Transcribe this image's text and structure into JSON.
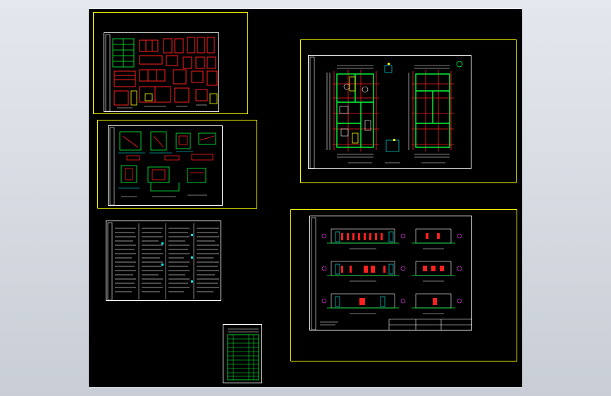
{
  "viewport": {
    "background_color": "#000000",
    "outer_color": "#d6dbe2"
  },
  "colors": {
    "frame": "#ffff00",
    "sheet_border": "#ffffff",
    "red": "#ff2020",
    "green": "#00ff3c",
    "cyan": "#00ffff",
    "white": "#ffffff",
    "magenta": "#ff40ff"
  },
  "sheets": [
    {
      "id": "sheet-door-window-details",
      "kind": "drawing"
    },
    {
      "id": "sheet-construction-details",
      "kind": "drawing"
    },
    {
      "id": "sheet-design-notes",
      "kind": "text"
    },
    {
      "id": "sheet-drawing-index",
      "kind": "table"
    },
    {
      "id": "sheet-floor-plans",
      "kind": "drawing"
    },
    {
      "id": "sheet-elevations",
      "kind": "drawing"
    }
  ]
}
